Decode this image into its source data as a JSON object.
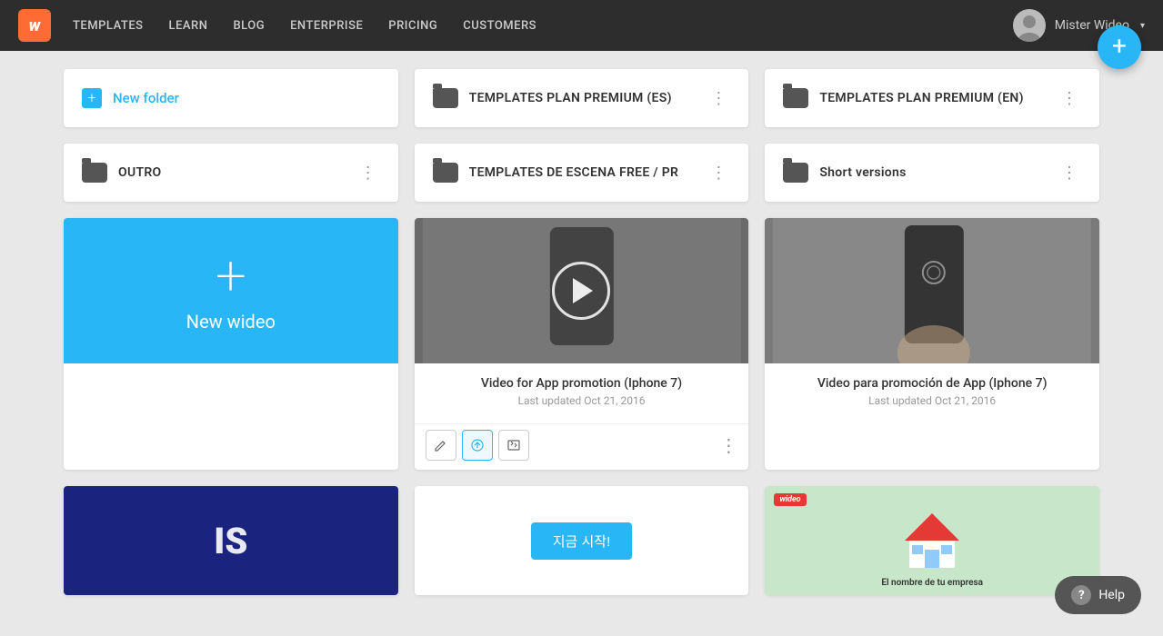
{
  "nav": {
    "logo_text": "w",
    "links": [
      "TEMPLATES",
      "LEARN",
      "BLOG",
      "ENTERPRISE",
      "PRICING",
      "CUSTOMERS"
    ],
    "user_name": "Mister Wideo",
    "user_chevron": "▾"
  },
  "fab": {
    "icon": "+"
  },
  "folders_row1": [
    {
      "type": "new-folder",
      "label": "New folder",
      "icon": "+"
    },
    {
      "type": "folder",
      "name": "TEMPLATES PLAN PREMIUM (ES)"
    },
    {
      "type": "folder",
      "name": "TEMPLATES PLAN PREMIUM (EN)"
    }
  ],
  "folders_row2": [
    {
      "type": "folder",
      "name": "OUTRO"
    },
    {
      "type": "folder",
      "name": "TEMPLATES DE ESCENA FREE / PR"
    },
    {
      "type": "folder",
      "name": "Short versions",
      "normal": true
    }
  ],
  "videos_row": [
    {
      "type": "new-wideo",
      "label": "New wideo"
    },
    {
      "type": "video",
      "title": "Video for App promotion (Iphone 7)",
      "date": "Last updated Oct 21, 2016",
      "has_actions": true
    },
    {
      "type": "video",
      "title": "Video para promoción de App (Iphone 7)",
      "date": "Last updated Oct 21, 2016",
      "has_actions": false
    }
  ],
  "bottom_row": [
    {
      "type": "partial"
    },
    {
      "type": "partial-blue"
    },
    {
      "type": "partial-house"
    }
  ],
  "actions": {
    "edit_label": "✎",
    "share_label": "⟳",
    "embed_label": "⊡"
  },
  "help": {
    "label": "Help",
    "icon": "?"
  }
}
